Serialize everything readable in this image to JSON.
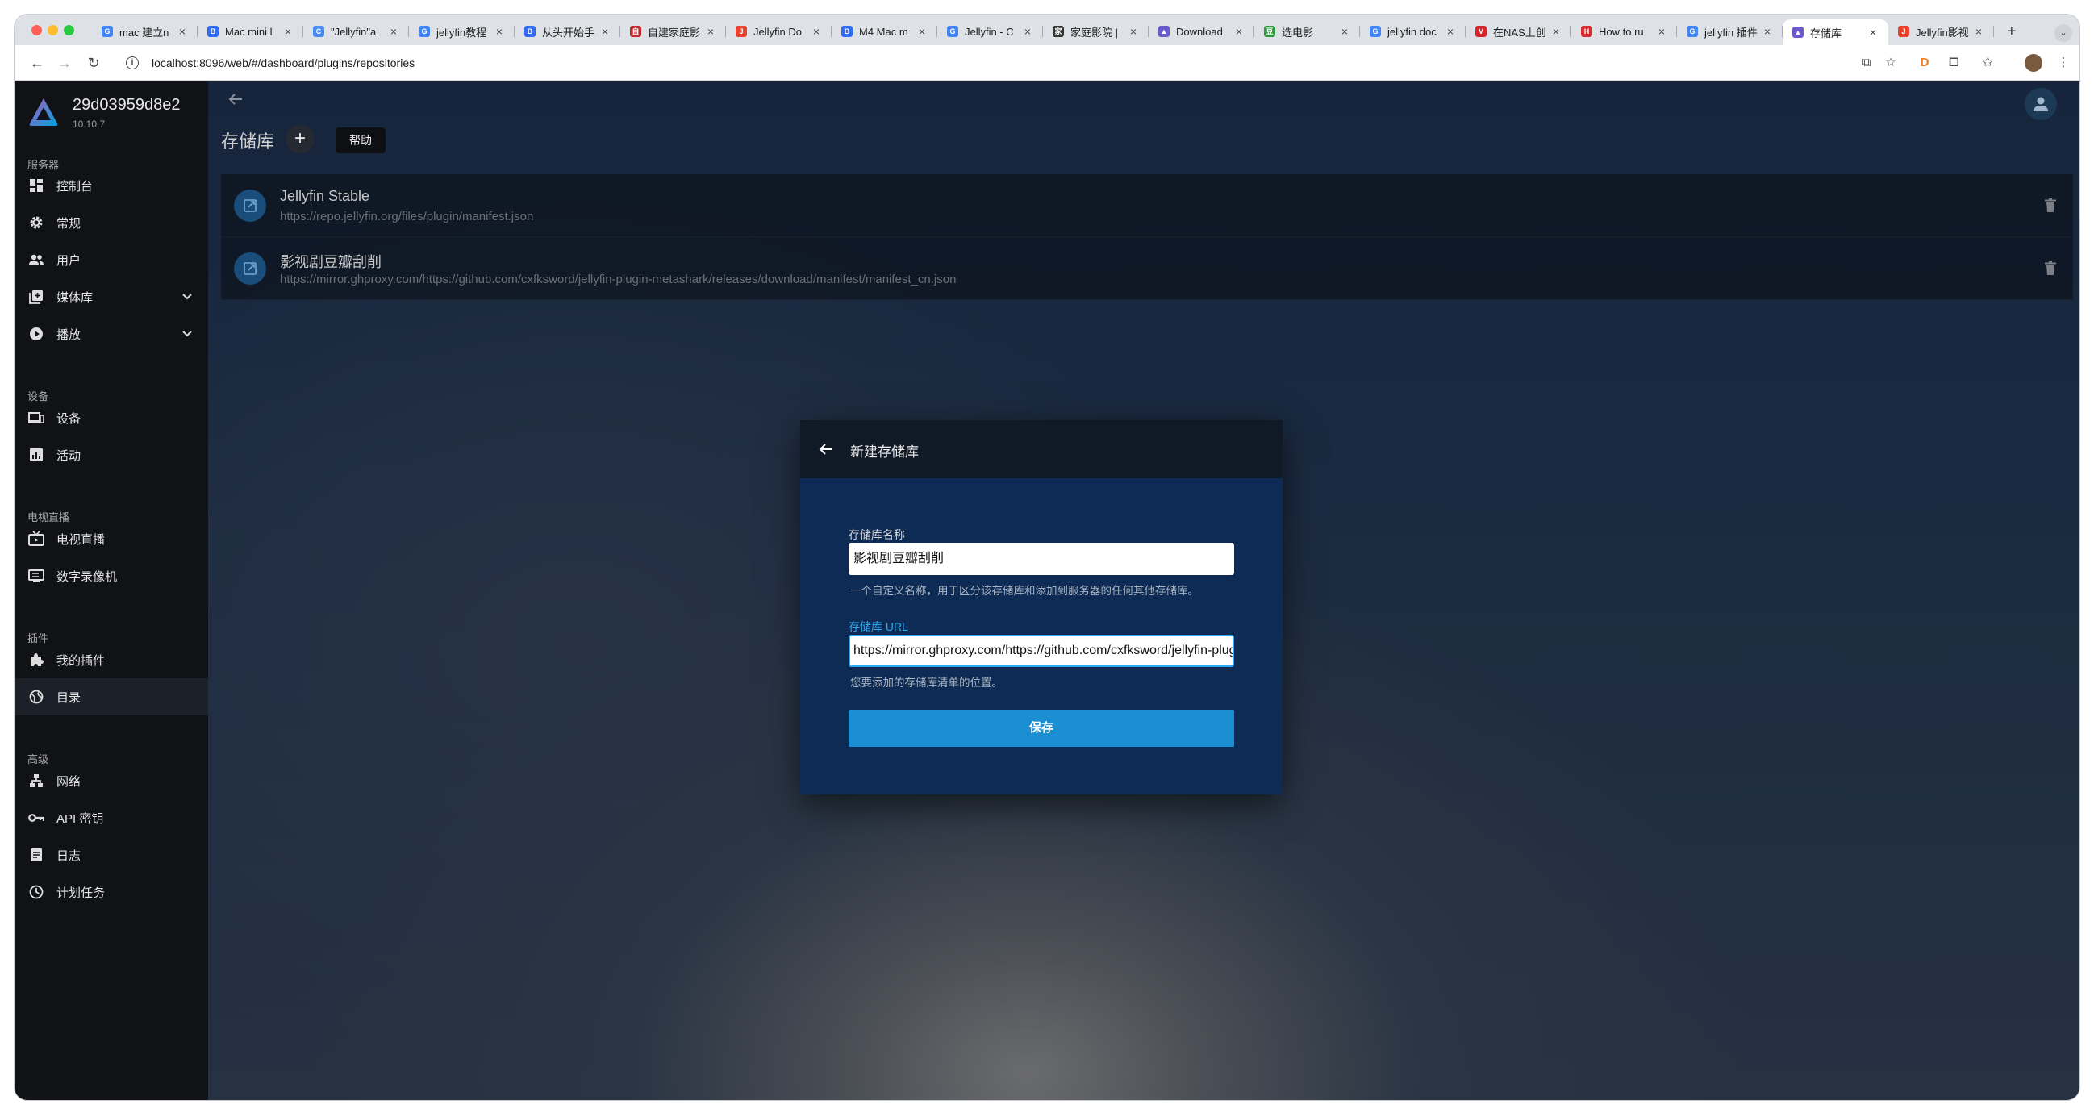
{
  "browser": {
    "tabs": [
      {
        "title": "mac 建立n",
        "icon": "google-icon",
        "color": "#4285f4",
        "glyph": "G"
      },
      {
        "title": "Mac mini l",
        "icon": "baidu-icon",
        "color": "#2f6cf3",
        "glyph": "B"
      },
      {
        "title": "\"Jellyfin\"a",
        "icon": "loading-icon",
        "color": "#4a8af4",
        "glyph": "C"
      },
      {
        "title": "jellyfin教程",
        "icon": "google-icon",
        "color": "#4285f4",
        "glyph": "G"
      },
      {
        "title": "从头开始手",
        "icon": "baidu-icon",
        "color": "#2f6cf3",
        "glyph": "B"
      },
      {
        "title": "自建家庭影",
        "icon": "site-icon",
        "color": "#c2292f",
        "glyph": "自"
      },
      {
        "title": "Jellyfin Do",
        "icon": "csdn-icon",
        "color": "#e8432e",
        "glyph": "J"
      },
      {
        "title": "M4 Mac m",
        "icon": "baidu-icon",
        "color": "#2f6cf3",
        "glyph": "B"
      },
      {
        "title": "Jellyfin - C",
        "icon": "google-icon",
        "color": "#4285f4",
        "glyph": "G"
      },
      {
        "title": "家庭影院 |",
        "icon": "site-icon",
        "color": "#333333",
        "glyph": "家"
      },
      {
        "title": "Download",
        "icon": "jellyfin-icon",
        "color": "#6a5acd",
        "glyph": "▲"
      },
      {
        "title": "选电影",
        "icon": "douban-icon",
        "color": "#2e963d",
        "glyph": "豆"
      },
      {
        "title": "jellyfin doc",
        "icon": "google-icon",
        "color": "#4285f4",
        "glyph": "G"
      },
      {
        "title": "在NAS上创",
        "icon": "vps-icon",
        "color": "#d6262c",
        "glyph": "V"
      },
      {
        "title": "How to ru",
        "icon": "site-icon",
        "color": "#d9282f",
        "glyph": "H"
      },
      {
        "title": "jellyfin 插件",
        "icon": "google-icon",
        "color": "#4285f4",
        "glyph": "G"
      },
      {
        "title": "存储库",
        "icon": "jellyfin-icon",
        "color": "#6a5acd",
        "glyph": "▲",
        "active": true
      },
      {
        "title": "Jellyfin影视",
        "icon": "csdn-icon",
        "color": "#e8432e",
        "glyph": "J"
      }
    ],
    "url": "localhost:8096/web/#/dashboard/plugins/repositories"
  },
  "sidebar": {
    "server_name": "29d03959d8e2",
    "server_version": "10.10.7",
    "sections": {
      "server": "服务器",
      "devices": "设备",
      "livetv": "电视直播",
      "plugins": "插件",
      "advanced": "高级"
    },
    "items": {
      "dashboard": "控制台",
      "general": "常规",
      "users": "用户",
      "libraries": "媒体库",
      "playback": "播放",
      "devices": "设备",
      "activity": "活动",
      "livetv": "电视直播",
      "dvr": "数字录像机",
      "my_plugins": "我的插件",
      "catalog": "目录",
      "networking": "网络",
      "api_keys": "API 密钥",
      "logs": "日志",
      "scheduled_tasks": "计划任务"
    }
  },
  "main": {
    "title": "存储库",
    "add_label": "+",
    "help_label": "帮助",
    "repositories": [
      {
        "name": "Jellyfin Stable",
        "url": "https://repo.jellyfin.org/files/plugin/manifest.json"
      },
      {
        "name": "影视剧豆瓣刮削",
        "url": "https://mirror.ghproxy.com/https://github.com/cxfksword/jellyfin-plugin-metashark/releases/download/manifest/manifest_cn.json"
      }
    ]
  },
  "dialog": {
    "title": "新建存储库",
    "name_label": "存储库名称",
    "name_value": "影视剧豆瓣刮削",
    "name_hint": "一个自定义名称，用于区分该存储库和添加到服务器的任何其他存储库。",
    "url_label": "存储库 URL",
    "url_value": "https://mirror.ghproxy.com/https://github.com/cxfksword/jellyfin-plugin-metashark/releases/download/manifest/manifest_cn.json",
    "url_hint": "您要添加的存储库清单的位置。",
    "save_label": "保存"
  },
  "colors": {
    "accent": "#1b8fd1",
    "dialog_bg": "#0d2b54",
    "sidebar_bg": "#101216"
  }
}
